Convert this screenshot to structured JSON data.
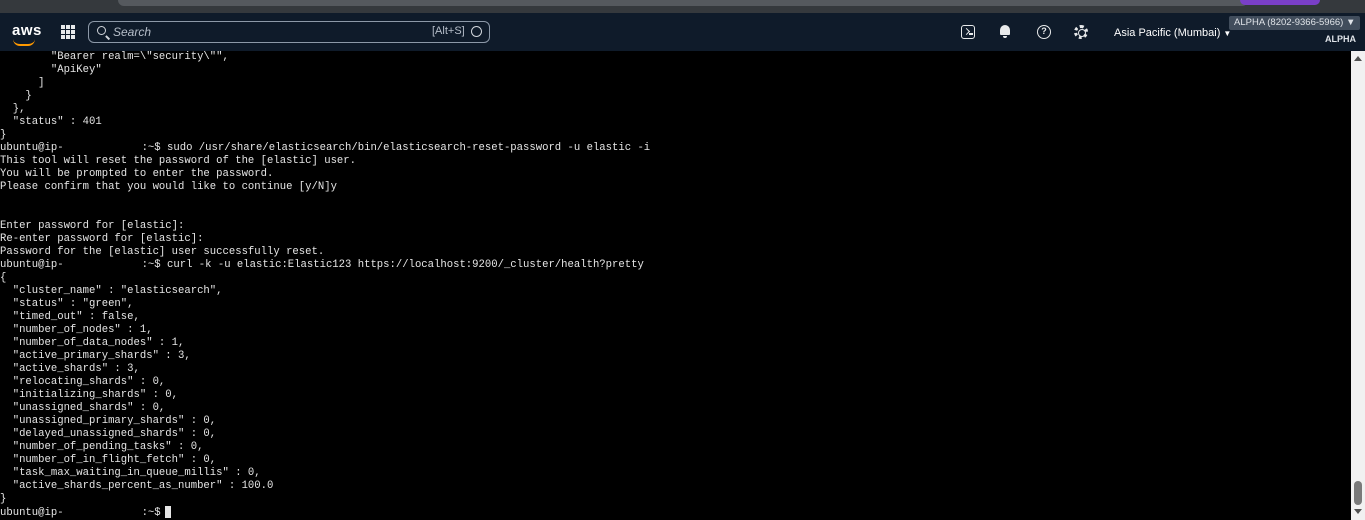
{
  "header": {
    "logo_text": "aws",
    "search": {
      "placeholder": "Search",
      "shortcut": "[Alt+S]"
    },
    "region": {
      "label": "Asia Pacific (Mumbai)",
      "caret": "▼"
    },
    "account": {
      "badge": "ALPHA (8202-9366-5966) ▼",
      "sub": "ALPHA"
    },
    "icons": [
      "grid-icon",
      "search-icon",
      "cloudshell-icon",
      "bell-icon",
      "help-icon",
      "gear-icon"
    ]
  },
  "colors": {
    "nav_bg": "#0f1b2a",
    "terminal_bg": "#000000",
    "terminal_fg": "#e6e6e6",
    "aws_orange": "#ff9900"
  },
  "terminal": {
    "lines": [
      "        \"Bearer realm=\\\"security\\\"\",",
      "        \"ApiKey\"",
      "      ]",
      "    }",
      "  },",
      "  \"status\" : 401",
      "}",
      "ubuntu@ip-",
      "This tool will reset the password of the [elastic] user.",
      "You will be prompted to enter the password.",
      "Please confirm that you would like to continue [y/N]y",
      "",
      "",
      "Enter password for [elastic]:",
      "Re-enter password for [elastic]:",
      "Password for the [elastic] user successfully reset.",
      "ubuntu@ip-",
      "{",
      "  \"cluster_name\" : \"elasticsearch\",",
      "  \"status\" : \"green\",",
      "  \"timed_out\" : false,",
      "  \"number_of_nodes\" : 1,",
      "  \"number_of_data_nodes\" : 1,",
      "  \"active_primary_shards\" : 3,",
      "  \"active_shards\" : 3,",
      "  \"relocating_shards\" : 0,",
      "  \"initializing_shards\" : 0,",
      "  \"unassigned_shards\" : 0,",
      "  \"unassigned_primary_shards\" : 0,",
      "  \"delayed_unassigned_shards\" : 0,",
      "  \"number_of_pending_tasks\" : 0,",
      "  \"number_of_in_flight_fetch\" : 0,",
      "  \"task_max_waiting_in_queue_millis\" : 0,",
      "  \"active_shards_percent_as_number\" : 100.0",
      "}",
      "ubuntu@ip-"
    ],
    "prompt_suffixes": {
      "7": ":~$ sudo /usr/share/elasticsearch/bin/elasticsearch-reset-password -u elastic -i",
      "16": ":~$ curl -k -u elastic:Elastic123 https://localhost:9200/_cluster/health?pretty",
      "35": ":~$"
    }
  }
}
